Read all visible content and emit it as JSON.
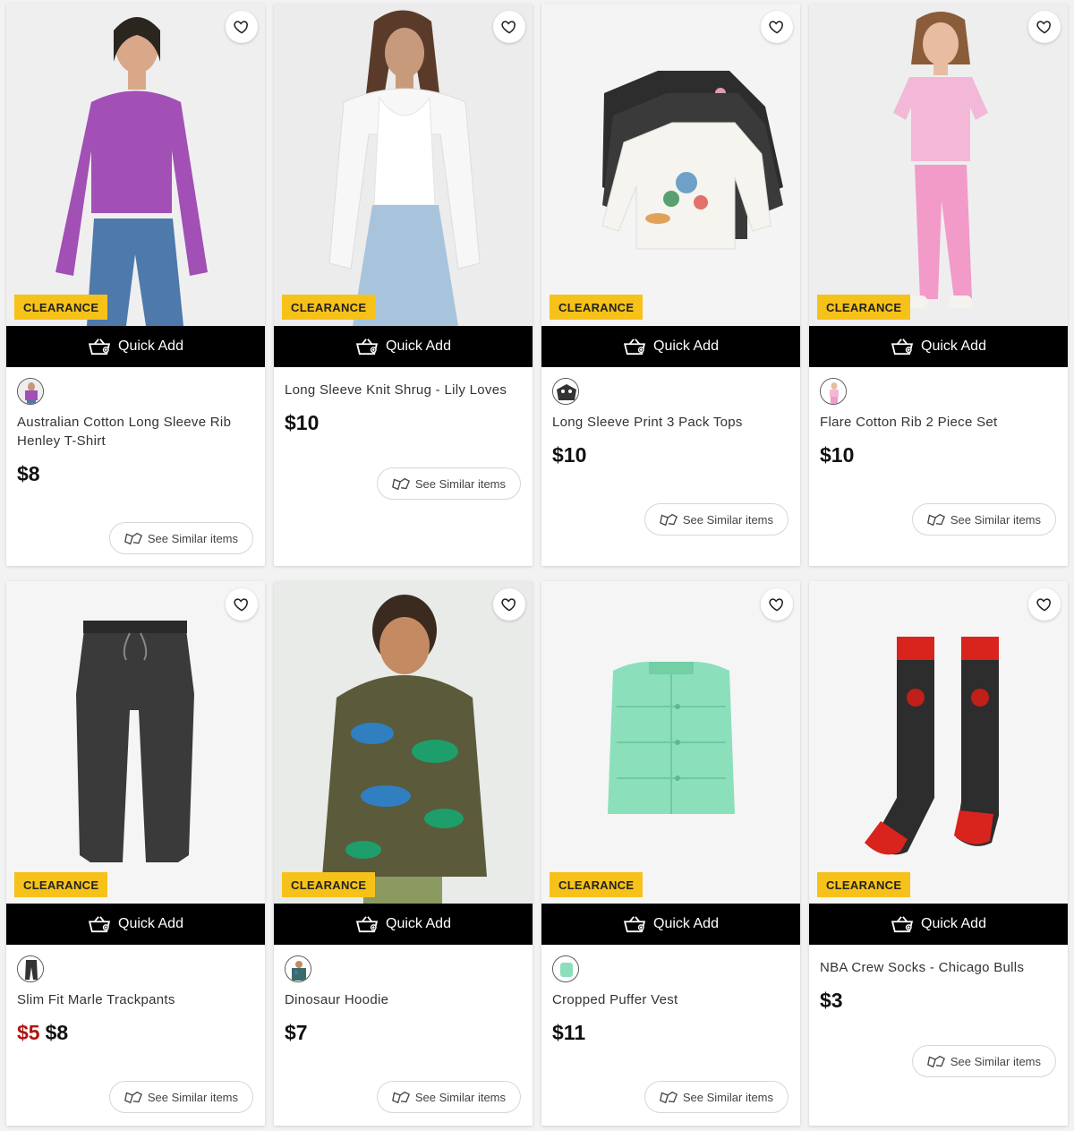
{
  "labels": {
    "badge": "CLEARANCE",
    "quick_add": "Quick Add",
    "see_similar": "See Similar items"
  },
  "colors": {
    "badge": "#f6c21a",
    "sale_price": "#b1140f",
    "quick_add_bar": "#000000"
  },
  "icons": {
    "wishlist": "heart-icon",
    "quick_add": "basket-icon",
    "similar": "similar-items-icon"
  },
  "products": [
    {
      "title": "Australian Cotton Long Sleeve Rib Henley T-Shirt",
      "price": "$8",
      "sale_price": null,
      "has_swatch": true
    },
    {
      "title": "Long Sleeve Knit Shrug - Lily Loves",
      "price": "$10",
      "sale_price": null,
      "has_swatch": false
    },
    {
      "title": "Long Sleeve Print 3 Pack Tops",
      "price": "$10",
      "sale_price": null,
      "has_swatch": true
    },
    {
      "title": "Flare Cotton Rib 2 Piece Set",
      "price": "$10",
      "sale_price": null,
      "has_swatch": true
    },
    {
      "title": "Slim Fit Marle Trackpants",
      "price": "$8",
      "sale_price": "$5",
      "has_swatch": true
    },
    {
      "title": "Dinosaur Hoodie",
      "price": "$7",
      "sale_price": null,
      "has_swatch": true
    },
    {
      "title": "Cropped Puffer Vest",
      "price": "$11",
      "sale_price": null,
      "has_swatch": true
    },
    {
      "title": "NBA Crew Socks - Chicago Bulls",
      "price": "$3",
      "sale_price": null,
      "has_swatch": false
    }
  ]
}
